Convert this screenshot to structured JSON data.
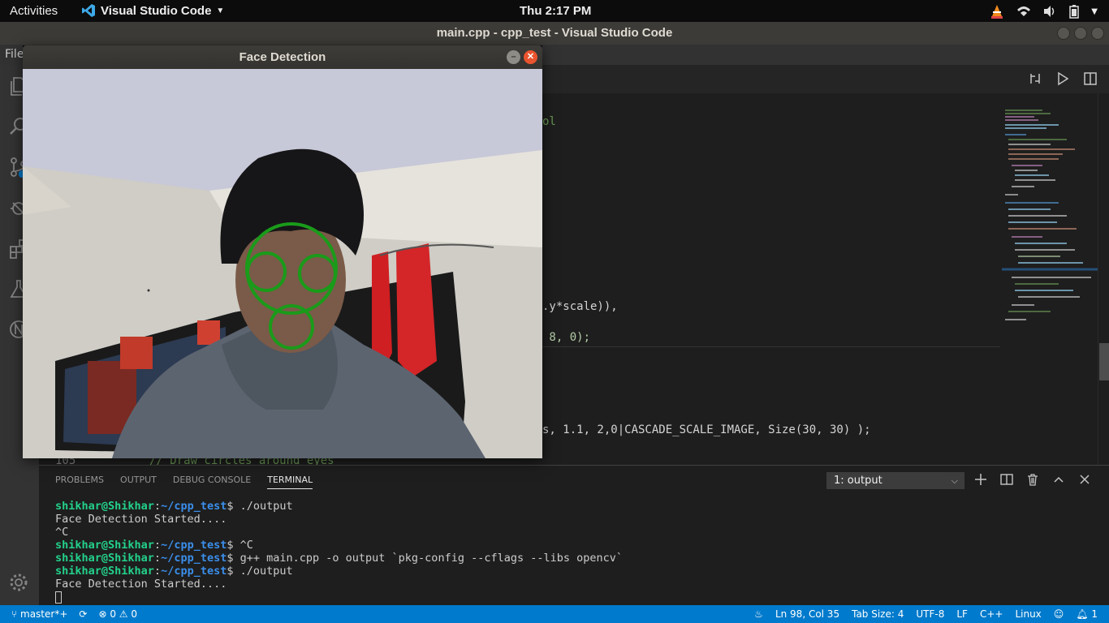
{
  "topbar": {
    "activities": "Activities",
    "app_name": "Visual Studio Code",
    "clock": "Thu  2:17 PM"
  },
  "window": {
    "title": "main.cpp - cpp_test - Visual Studio Code",
    "menu_visible": "File"
  },
  "face_window": {
    "title": "Face Detection"
  },
  "editor": {
    "visible_fragments": {
      "line_a": "ol",
      "line_b": ".y*scale)),",
      "line_c": " 8, 0);",
      "line_d": "s, 1.1, 2,0|CASCADE_SCALE_IMAGE, Size(30, 30) );",
      "line_num": "105",
      "line_comment": "// Draw circles around eyes"
    }
  },
  "panel": {
    "tabs": [
      "PROBLEMS",
      "OUTPUT",
      "DEBUG CONSOLE",
      "TERMINAL"
    ],
    "active_tab": "TERMINAL",
    "terminal_selector": "1: output",
    "terminal_lines": [
      {
        "user": "shikhar@Shikhar",
        "path": "~/cpp_test",
        "cmd": "./output"
      },
      {
        "text": "Face Detection Started...."
      },
      {
        "text": "^C"
      },
      {
        "user": "shikhar@Shikhar",
        "path": "~/cpp_test",
        "cmd": "^C"
      },
      {
        "user": "shikhar@Shikhar",
        "path": "~/cpp_test",
        "cmd": "g++ main.cpp -o output `pkg-config --cflags --libs opencv`"
      },
      {
        "user": "shikhar@Shikhar",
        "path": "~/cpp_test",
        "cmd": "./output"
      },
      {
        "text": "Face Detection Started...."
      }
    ]
  },
  "statusbar": {
    "branch": "master*+",
    "errors": "0",
    "warnings": "0",
    "position": "Ln 98, Col 35",
    "tab_size": "Tab Size: 4",
    "encoding": "UTF-8",
    "eol": "LF",
    "language": "C++",
    "os": "Linux",
    "notifications": "1"
  },
  "colors": {
    "statusbar": "#007acc",
    "detect_circle": "#1a9b1a",
    "terminal_user": "#23d18b",
    "terminal_path": "#3b8eea"
  }
}
